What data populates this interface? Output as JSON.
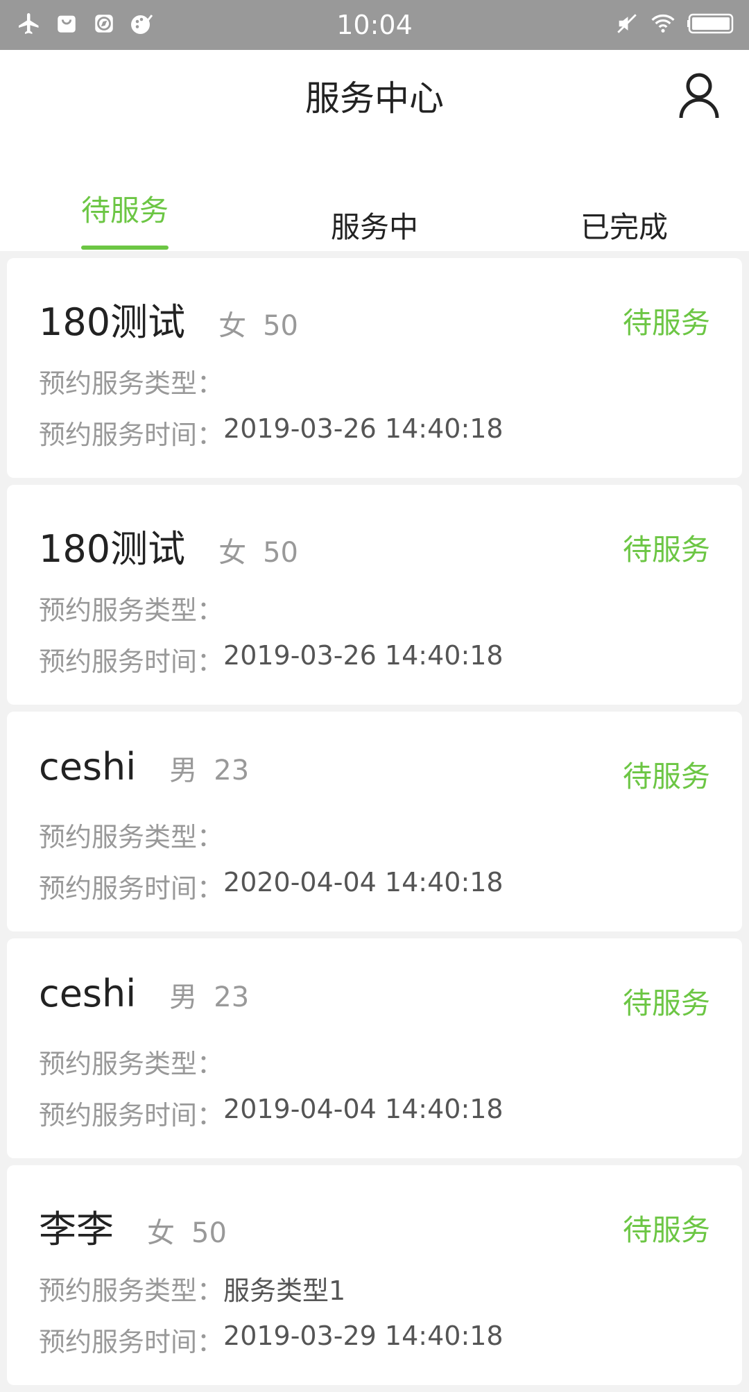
{
  "status_bar": {
    "time": "10:04",
    "left_icons": [
      "airplane-icon",
      "bag-icon",
      "compass-icon",
      "palette-icon"
    ],
    "right_icons": [
      "mute-icon",
      "wifi-icon",
      "battery-icon"
    ]
  },
  "header": {
    "title": "服务中心"
  },
  "tabs": [
    {
      "label": "待服务",
      "active": true
    },
    {
      "label": "服务中",
      "active": false
    },
    {
      "label": "已完成",
      "active": false
    }
  ],
  "labels": {
    "service_type": "预约服务类型：",
    "service_time": "预约服务时间："
  },
  "cards": [
    {
      "name": "180测试",
      "gender": "女",
      "age": "50",
      "status": "待服务",
      "service_type": "",
      "service_time": "2019-03-26 14:40:18"
    },
    {
      "name": "180测试",
      "gender": "女",
      "age": "50",
      "status": "待服务",
      "service_type": "",
      "service_time": "2019-03-26 14:40:18"
    },
    {
      "name": "ceshi",
      "gender": "男",
      "age": "23",
      "status": "待服务",
      "service_type": "",
      "service_time": "2020-04-04 14:40:18"
    },
    {
      "name": "ceshi",
      "gender": "男",
      "age": "23",
      "status": "待服务",
      "service_type": "",
      "service_time": "2019-04-04 14:40:18"
    },
    {
      "name": "李李",
      "gender": "女",
      "age": "50",
      "status": "待服务",
      "service_type": "服务类型1",
      "service_time": "2019-03-29 14:40:18"
    }
  ],
  "colors": {
    "accent": "#6cc644",
    "status_bar": "#999999",
    "background": "#f2f2f2"
  }
}
